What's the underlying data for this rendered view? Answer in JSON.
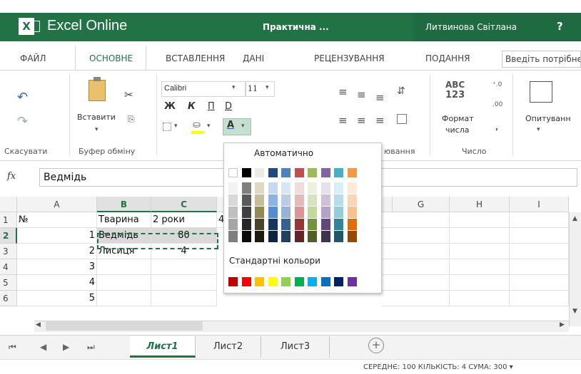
{
  "app": {
    "title": "Excel Online",
    "doc_title": "Практична ...",
    "user": "Литвинова Світлана",
    "help": "?"
  },
  "tabs": [
    "ФАЙЛ",
    "ОСНОВНЕ",
    "ВСТАВЛЕННЯ",
    "ДАНІ",
    "РЕЦЕНЗУВАННЯ",
    "ПОДАННЯ"
  ],
  "tell_me": "Введіть потрібне",
  "ribbon": {
    "undo_group": "Скасувати",
    "clipboard_group": "Буфер обміну",
    "paste_label": "Вставити",
    "font_name": "Calibri",
    "font_size": "11",
    "bold": "Ж",
    "italic": "К",
    "underline": "П",
    "strike": "D",
    "align_group_partial": "ювання",
    "number_format_top": "ABC",
    "number_format_mid": "123",
    "number_format_label": "Формат",
    "number_format_label2": "числа",
    "number_group": "Число",
    "survey_label": "Опитуванн"
  },
  "formula_bar": {
    "fx": "fx",
    "value": "Ведмідь"
  },
  "columns": [
    "A",
    "B",
    "C",
    "",
    "",
    "",
    "G",
    "H",
    "I"
  ],
  "rows": [
    "1",
    "2",
    "3",
    "4",
    "5",
    "6"
  ],
  "cells": {
    "A1": "№",
    "B1": "Тварина",
    "C1": "2 роки",
    "D1": "4",
    "A2": "1",
    "B2": "Ведмідь",
    "C2": "80",
    "A3": "2",
    "B3": "Лисиця",
    "C3": "4",
    "A4": "3",
    "A5": "4",
    "A6": "5"
  },
  "palette": {
    "automatic": "Автоматично",
    "standard": "Стандартні кольори",
    "theme_top": [
      "#ffffff",
      "#000000",
      "#eeece1",
      "#1f497d",
      "#4f81bd",
      "#c0504d",
      "#9bbb59",
      "#8064a2",
      "#4bacc6",
      "#f79646"
    ],
    "theme_shades": [
      [
        "#f2f2f2",
        "#7f7f7f",
        "#ddd9c3",
        "#c6d9f0",
        "#dbe5f1",
        "#f2dcdb",
        "#ebf1dd",
        "#e5e0ec",
        "#dbeef3",
        "#fdeada"
      ],
      [
        "#d8d8d8",
        "#595959",
        "#c4bd97",
        "#8db3e2",
        "#b8cce4",
        "#e5b9b7",
        "#d7e3bc",
        "#ccc1d9",
        "#b7dde8",
        "#fbd5b5"
      ],
      [
        "#bfbfbf",
        "#3f3f3f",
        "#938953",
        "#548dd4",
        "#95b3d7",
        "#d99694",
        "#c3d69b",
        "#b2a2c7",
        "#92cddc",
        "#fac08f"
      ],
      [
        "#a5a5a5",
        "#262626",
        "#494429",
        "#17365d",
        "#366092",
        "#953734",
        "#76923c",
        "#5f497a",
        "#31859b",
        "#e36c09"
      ],
      [
        "#7f7f7f",
        "#0c0c0c",
        "#1d1b10",
        "#0f243e",
        "#244061",
        "#632423",
        "#4f6128",
        "#3f3151",
        "#205867",
        "#974806"
      ]
    ],
    "standard_colors": [
      "#c00000",
      "#ff0000",
      "#ffc000",
      "#ffff00",
      "#92d050",
      "#00b050",
      "#00b0f0",
      "#0070c0",
      "#002060",
      "#7030a0"
    ]
  },
  "sheets": [
    "Лист1",
    "Лист2",
    "Лист3"
  ],
  "status": "СЕРЕДНЄ: 100   КІЛЬКІСТЬ: 4   СУМА: 300   ▾"
}
